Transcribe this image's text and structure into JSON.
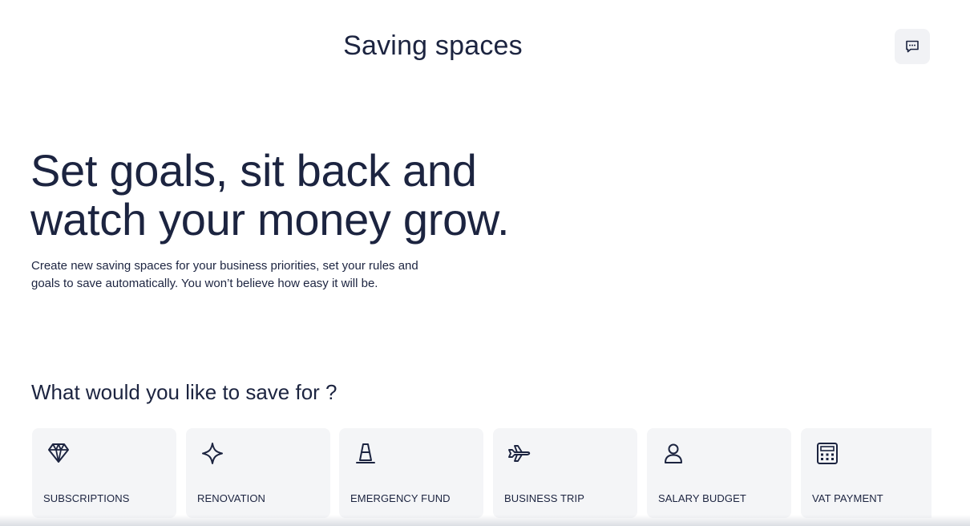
{
  "header": {
    "title": "Saving spaces"
  },
  "chat_button": {
    "icon": "chat-icon"
  },
  "hero": {
    "heading_line1": "Set goals, sit back and",
    "heading_line2": "watch your money grow.",
    "subtitle_line1": "Create new saving spaces for your business priorities, set your rules and",
    "subtitle_line2": "goals to save automatically. You won’t believe how easy it will be."
  },
  "goals": {
    "heading": "What would you like to save for ?",
    "items": [
      {
        "label": "SUBSCRIPTIONS",
        "icon": "diamond-icon"
      },
      {
        "label": "RENOVATION",
        "icon": "sparkle-icon"
      },
      {
        "label": "EMERGENCY FUND",
        "icon": "traffic-cone-icon"
      },
      {
        "label": "BUSINESS TRIP",
        "icon": "airplane-icon"
      },
      {
        "label": "SALARY BUDGET",
        "icon": "person-icon"
      },
      {
        "label": "VAT PAYMENT",
        "icon": "calculator-icon"
      }
    ]
  },
  "colors": {
    "text": "#1c2440",
    "card_background": "#f4f5f7",
    "button_background": "#f1f2f5"
  }
}
